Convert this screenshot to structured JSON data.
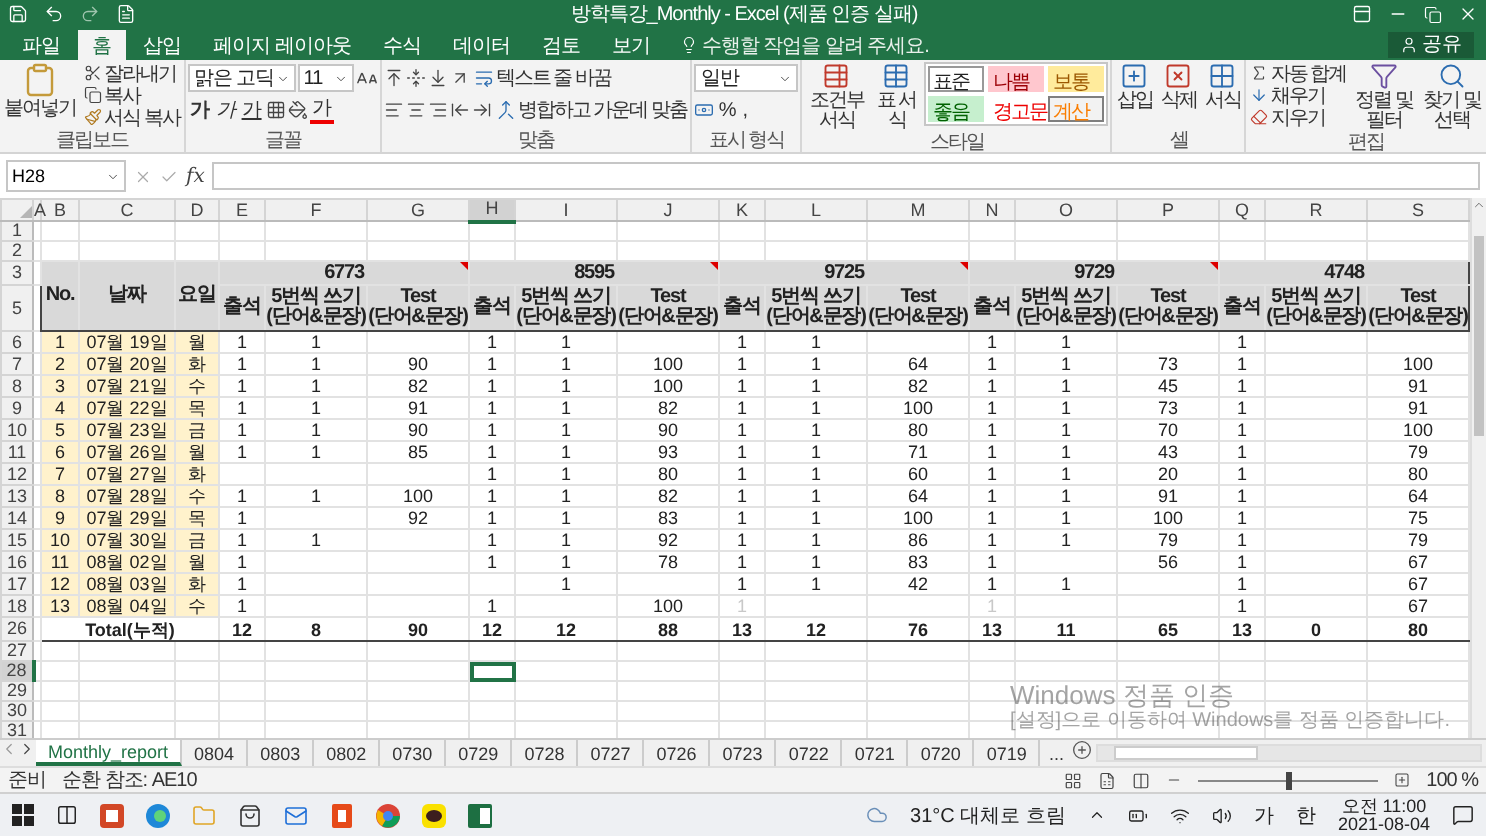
{
  "window": {
    "title": "방학특강_Monthly - Excel (제품 인증 실패)"
  },
  "ribbon_tabs": [
    {
      "label": "파일",
      "selected": false
    },
    {
      "label": "홈",
      "selected": true
    },
    {
      "label": "삽입",
      "selected": false
    },
    {
      "label": "페이지 레이아웃",
      "selected": false
    },
    {
      "label": "수식",
      "selected": false
    },
    {
      "label": "데이터",
      "selected": false
    },
    {
      "label": "검토",
      "selected": false
    },
    {
      "label": "보기",
      "selected": false
    }
  ],
  "tell_me": "수행할 작업을 알려 주세요.",
  "share": "공유",
  "ribbon": {
    "clipboard": {
      "paste": "붙여넣기",
      "cut": "잘라내기",
      "copy": "복사",
      "format_painter": "서식 복사",
      "label": "클립보드"
    },
    "font": {
      "name": "맑은 고딕",
      "size": "11",
      "bold": "가",
      "italic": "가",
      "underline": "가",
      "font_color_button": "가",
      "label": "글꼴"
    },
    "alignment": {
      "wrap": "텍스트 줄 바꿈",
      "merge": "병합하고 가운데 맞춤",
      "label": "맞춤"
    },
    "number": {
      "format": "일반",
      "percent": "%",
      "comma": ",",
      "label": "표시 형식"
    },
    "styles": {
      "conditional": "조건부 서식",
      "table": "표 서식",
      "label": "스타일",
      "gallery": [
        {
          "label": "표준",
          "kind": "normal"
        },
        {
          "label": "나쁨",
          "kind": "bad"
        },
        {
          "label": "보통",
          "kind": "neutral"
        },
        {
          "label": "좋음",
          "kind": "good"
        },
        {
          "label": "경고문",
          "kind": "warning"
        },
        {
          "label": "계산",
          "kind": "calculation"
        }
      ]
    },
    "cells": {
      "insert": "삽입",
      "delete": "삭제",
      "format": "서식",
      "label": "셀"
    },
    "editing": {
      "autosum": "자동 합계",
      "fill": "채우기",
      "clear": "지우기",
      "sort": "정렬 및 필터",
      "find": "찾기 및 선택",
      "label": "편집"
    }
  },
  "formula_bar": {
    "name_box": "H28",
    "function_label": "fx"
  },
  "columns": [
    {
      "label": "A",
      "selected": false
    },
    {
      "label": "B",
      "selected": false
    },
    {
      "label": "C",
      "selected": false
    },
    {
      "label": "D",
      "selected": false
    },
    {
      "label": "E",
      "selected": false
    },
    {
      "label": "F",
      "selected": false
    },
    {
      "label": "G",
      "selected": false
    },
    {
      "label": "H",
      "selected": true
    },
    {
      "label": "I",
      "selected": false
    },
    {
      "label": "J",
      "selected": false
    },
    {
      "label": "K",
      "selected": false
    },
    {
      "label": "L",
      "selected": false
    },
    {
      "label": "M",
      "selected": false
    },
    {
      "label": "N",
      "selected": false
    },
    {
      "label": "O",
      "selected": false
    },
    {
      "label": "P",
      "selected": false
    },
    {
      "label": "Q",
      "selected": false
    },
    {
      "label": "R",
      "selected": false
    },
    {
      "label": "S",
      "selected": false
    }
  ],
  "sheet": {
    "top_rows": [
      "1",
      "2"
    ],
    "header_rows": [
      "3",
      "5"
    ],
    "headers": {
      "no": "No.",
      "date": "날짜",
      "day": "요일"
    },
    "students": [
      {
        "id": "6773",
        "comment": true,
        "columns": [
          "출석",
          "5번씩 쓰기\n(단어&문장)",
          "Test\n(단어&문장)"
        ]
      },
      {
        "id": "8595",
        "comment": true,
        "columns": [
          "출석",
          "5번씩 쓰기\n(단어&문장)",
          "Test\n(단어&문장)"
        ]
      },
      {
        "id": "9725",
        "comment": true,
        "columns": [
          "출석",
          "5번씩 쓰기\n(단어&문장)",
          "Test\n(단어&문장)"
        ]
      },
      {
        "id": "9729",
        "comment": true,
        "columns": [
          "출석",
          "5번씩 쓰기\n(단어&문장)",
          "Test\n(단어&문장)"
        ]
      },
      {
        "id": "4748",
        "comment": false,
        "columns": [
          "출석",
          "5번씩 쓰기\n(단어&문장)",
          "Test\n(단어&문장)"
        ]
      }
    ],
    "rows": [
      {
        "row": "6",
        "no": "1",
        "date": "07월 19일",
        "day": "월",
        "cells": [
          "1",
          "1",
          null,
          "1",
          "1",
          null,
          "1",
          "1",
          null,
          "1",
          "1",
          null,
          "1",
          null,
          null
        ]
      },
      {
        "row": "7",
        "no": "2",
        "date": "07월 20일",
        "day": "화",
        "cells": [
          "1",
          "1",
          "90",
          "1",
          "1",
          "100",
          "1",
          "1",
          "64",
          "1",
          "1",
          "73",
          "1",
          null,
          "100"
        ]
      },
      {
        "row": "8",
        "no": "3",
        "date": "07월 21일",
        "day": "수",
        "cells": [
          "1",
          "1",
          "82",
          "1",
          "1",
          "100",
          "1",
          "1",
          "82",
          "1",
          "1",
          "45",
          "1",
          null,
          "91"
        ]
      },
      {
        "row": "9",
        "no": "4",
        "date": "07월 22일",
        "day": "목",
        "cells": [
          "1",
          "1",
          "91",
          "1",
          "1",
          "82",
          "1",
          "1",
          "100",
          "1",
          "1",
          "73",
          "1",
          null,
          "91"
        ]
      },
      {
        "row": "10",
        "no": "5",
        "date": "07월 23일",
        "day": "금",
        "cells": [
          "1",
          "1",
          "90",
          "1",
          "1",
          "90",
          "1",
          "1",
          "80",
          "1",
          "1",
          "70",
          "1",
          null,
          "100"
        ]
      },
      {
        "row": "11",
        "no": "6",
        "date": "07월 26일",
        "day": "월",
        "cells": [
          "1",
          "1",
          "85",
          "1",
          "1",
          "93",
          "1",
          "1",
          "71",
          "1",
          "1",
          "43",
          "1",
          null,
          "79"
        ]
      },
      {
        "row": "12",
        "no": "7",
        "date": "07월 27일",
        "day": "화",
        "cells": [
          null,
          null,
          null,
          "1",
          "1",
          "80",
          "1",
          "1",
          "60",
          "1",
          "1",
          "20",
          "1",
          null,
          "80"
        ]
      },
      {
        "row": "13",
        "no": "8",
        "date": "07월 28일",
        "day": "수",
        "cells": [
          "1",
          "1",
          "100",
          "1",
          "1",
          "82",
          "1",
          "1",
          "64",
          "1",
          "1",
          "91",
          "1",
          null,
          "64"
        ]
      },
      {
        "row": "14",
        "no": "9",
        "date": "07월 29일",
        "day": "목",
        "cells": [
          "1",
          null,
          "92",
          "1",
          "1",
          "83",
          "1",
          "1",
          "100",
          "1",
          "1",
          "100",
          "1",
          null,
          "75"
        ]
      },
      {
        "row": "15",
        "no": "10",
        "date": "07월 30일",
        "day": "금",
        "cells": [
          "1",
          "1",
          null,
          "1",
          "1",
          "92",
          "1",
          "1",
          "86",
          "1",
          "1",
          "79",
          "1",
          null,
          "79"
        ]
      },
      {
        "row": "16",
        "no": "11",
        "date": "08월 02일",
        "day": "월",
        "cells": [
          "1",
          null,
          null,
          "1",
          "1",
          "78",
          "1",
          "1",
          "83",
          "1",
          null,
          "56",
          "1",
          null,
          "67"
        ]
      },
      {
        "row": "17",
        "no": "12",
        "date": "08월 03일",
        "day": "화",
        "cells": [
          "1",
          null,
          null,
          null,
          "1",
          null,
          "1",
          "1",
          "42",
          "1",
          "1",
          null,
          "1",
          null,
          "67"
        ]
      },
      {
        "row": "18",
        "no": "13",
        "date": "08월 04일",
        "day": "수",
        "cells": [
          "1",
          null,
          null,
          "1",
          null,
          "100",
          {
            "text": "1",
            "greyed": true
          },
          null,
          null,
          {
            "text": "1",
            "greyed": true
          },
          null,
          null,
          "1",
          null,
          "67"
        ]
      }
    ],
    "total": {
      "row": "26",
      "label": "Total(누적)",
      "cells": [
        "12",
        "8",
        "90",
        "12",
        "12",
        "88",
        "13",
        "12",
        "76",
        "13",
        "11",
        "65",
        "13",
        "0",
        "80"
      ]
    },
    "blank_rows": [
      {
        "row": "27",
        "selected": false
      },
      {
        "row": "28",
        "selected": true
      },
      {
        "row": "29",
        "selected": false
      },
      {
        "row": "30",
        "selected": false
      },
      {
        "row": "31",
        "selected": false
      }
    ]
  },
  "activation": {
    "title": "Windows 정품 인증",
    "message": "[설정]으로 이동하여 Windows를 정품 인증합니다."
  },
  "sheet_tabs": [
    {
      "label": "Monthly_report",
      "selected": true
    },
    {
      "label": "0804",
      "selected": false
    },
    {
      "label": "0803",
      "selected": false
    },
    {
      "label": "0802",
      "selected": false
    },
    {
      "label": "0730",
      "selected": false
    },
    {
      "label": "0729",
      "selected": false
    },
    {
      "label": "0728",
      "selected": false
    },
    {
      "label": "0727",
      "selected": false
    },
    {
      "label": "0726",
      "selected": false
    },
    {
      "label": "0723",
      "selected": false
    },
    {
      "label": "0722",
      "selected": false
    },
    {
      "label": "0721",
      "selected": false
    },
    {
      "label": "0720",
      "selected": false
    },
    {
      "label": "0719",
      "selected": false
    }
  ],
  "more_tabs": "...",
  "status": {
    "mode": "준비",
    "circular": "순환 참조: AE10",
    "zoom": {
      "level": 0.5,
      "reading": "100 %"
    }
  },
  "taskbar": {
    "weather": "31°C 대체로 흐림",
    "ime": "가",
    "ime_mode": "한",
    "time": "오전 11:00",
    "date": "2021-08-04"
  }
}
